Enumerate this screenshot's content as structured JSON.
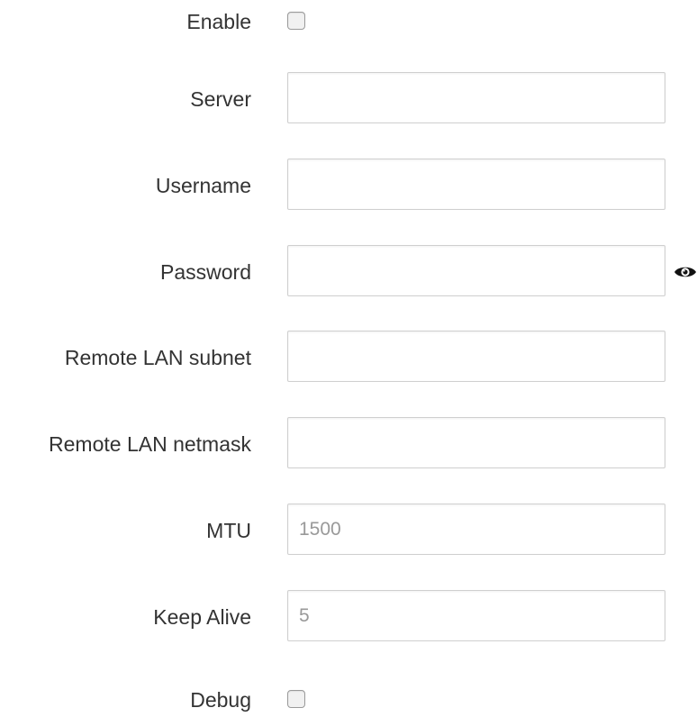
{
  "form": {
    "enable": {
      "label": "Enable",
      "checked": false
    },
    "server": {
      "label": "Server",
      "value": "",
      "placeholder": ""
    },
    "username": {
      "label": "Username",
      "value": "",
      "placeholder": ""
    },
    "password": {
      "label": "Password",
      "value": "",
      "placeholder": "",
      "reveal_icon": "eye-icon"
    },
    "remote_lan_subnet": {
      "label": "Remote LAN subnet",
      "value": "",
      "placeholder": ""
    },
    "remote_lan_netmask": {
      "label": "Remote LAN netmask",
      "value": "",
      "placeholder": ""
    },
    "mtu": {
      "label": "MTU",
      "value": "",
      "placeholder": "1500"
    },
    "keep_alive": {
      "label": "Keep Alive",
      "value": "",
      "placeholder": "5"
    },
    "debug": {
      "label": "Debug",
      "checked": false
    }
  },
  "colors": {
    "label_text": "#333333",
    "input_border": "#cfcfcf",
    "placeholder_text": "#999999"
  }
}
